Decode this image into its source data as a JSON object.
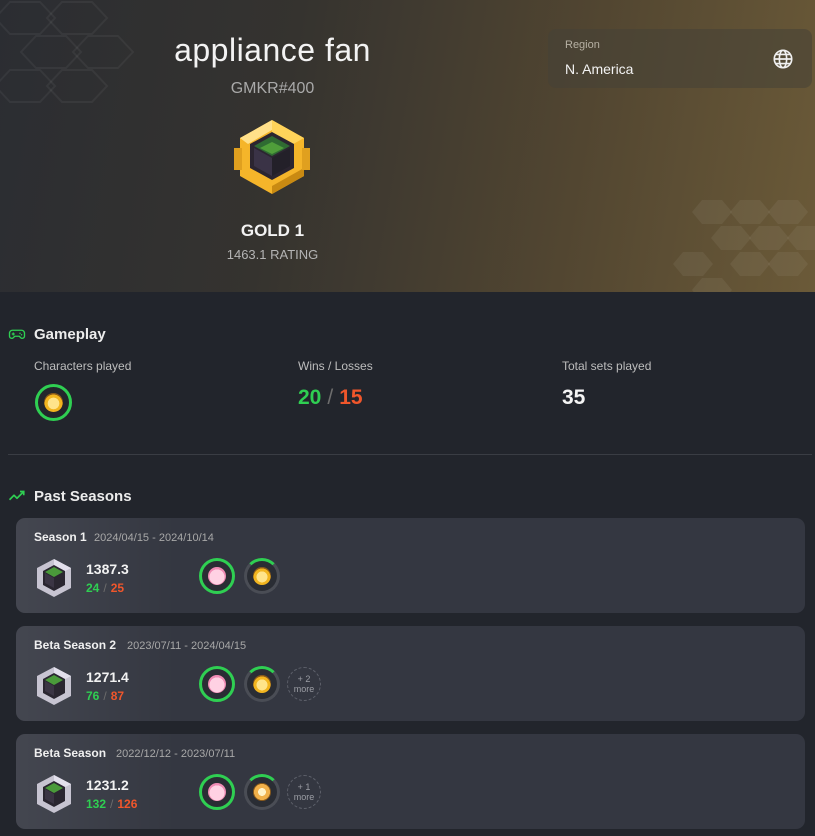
{
  "header": {
    "player_name": "appliance fan",
    "player_tag": "GMKR#400",
    "rank_name": "GOLD 1",
    "rating_text": "1463.1 RATING",
    "region_label": "Region",
    "region_value": "N. America"
  },
  "gameplay": {
    "title": "Gameplay",
    "characters_label": "Characters played",
    "wl_label": "Wins / Losses",
    "wins": "20",
    "losses": "15",
    "total_label": "Total sets played",
    "total_sets": "35"
  },
  "past_seasons": {
    "title": "Past Seasons",
    "seasons": [
      {
        "name": "Season 1",
        "dates": "2024/04/15 - 2024/10/14",
        "rating": "1387.3",
        "wins": "24",
        "losses": "25",
        "more_count": "",
        "more_label": ""
      },
      {
        "name": "Beta Season 2",
        "dates": "2023/07/11 - 2024/04/15",
        "rating": "1271.4",
        "wins": "76",
        "losses": "87",
        "more_count": "+ 2",
        "more_label": "more"
      },
      {
        "name": "Beta Season",
        "dates": "2022/12/12 - 2023/07/11",
        "rating": "1231.2",
        "wins": "132",
        "losses": "126",
        "more_count": "+ 1",
        "more_label": "more"
      }
    ]
  },
  "colors": {
    "win": "#2fcf52",
    "loss": "#f0562b",
    "accent_gold": "#f5b52a",
    "ring_green": "#2fcf52"
  },
  "icons": {
    "region": "globe-icon",
    "gameplay": "gamepad-icon",
    "past_seasons": "trend-up-icon"
  }
}
